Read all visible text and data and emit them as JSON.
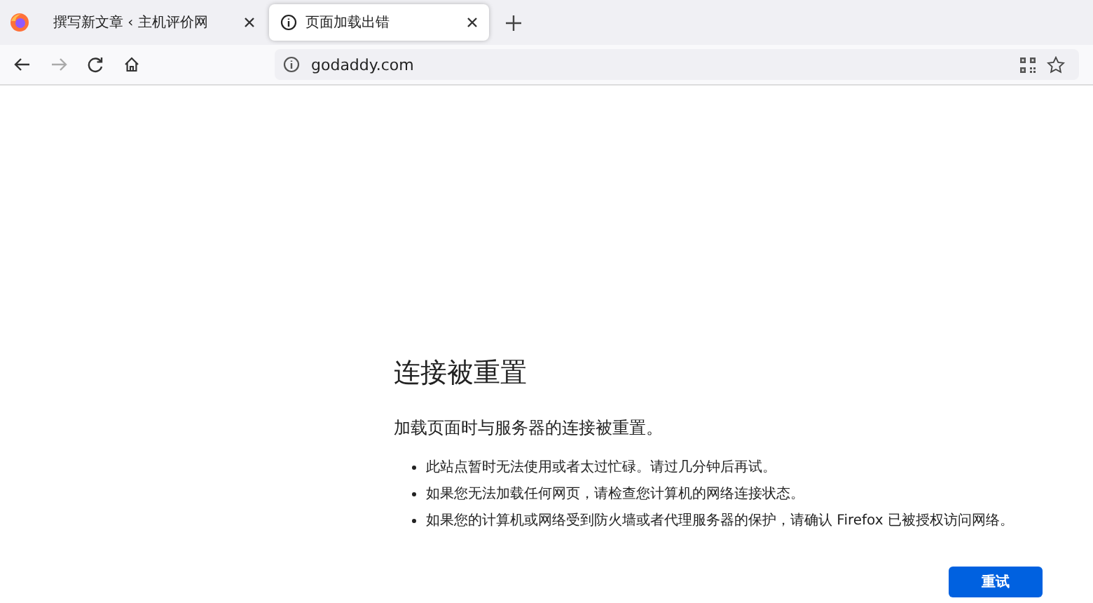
{
  "tabs": [
    {
      "title": "撰写新文章 ‹ 主机评价网",
      "selected": false,
      "kind": "site"
    },
    {
      "title": "页面加载出错",
      "selected": true,
      "kind": "info"
    }
  ],
  "address_bar": {
    "url": "godaddy.com"
  },
  "error": {
    "title": "连接被重置",
    "summary": "加载页面时与服务器的连接被重置。",
    "bullets": [
      "此站点暂时无法使用或者太过忙碌。请过几分钟后再试。",
      "如果您无法加载任何网页，请检查您计算机的网络连接状态。",
      "如果您的计算机或网络受到防火墙或者代理服务器的保护，请确认 Firefox 已被授权访问网络。"
    ],
    "button": "重试"
  }
}
